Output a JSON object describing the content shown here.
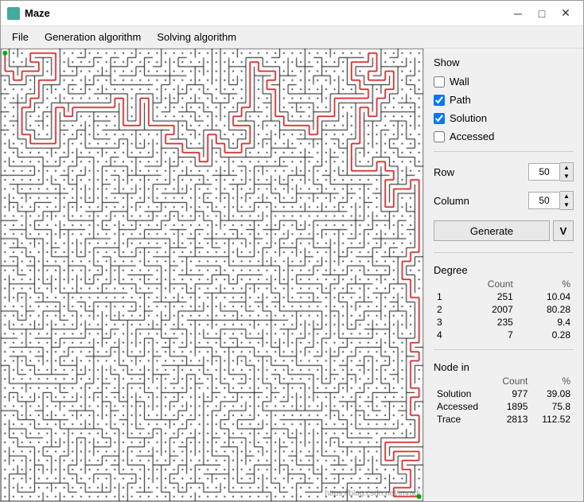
{
  "window": {
    "title": "Maze",
    "icon_color": "#4a9",
    "min_label": "─",
    "max_label": "□",
    "close_label": "✕"
  },
  "menu": {
    "items": [
      {
        "id": "file",
        "label": "File"
      },
      {
        "id": "generation",
        "label": "Generation algorithm"
      },
      {
        "id": "solving",
        "label": "Solving algorithm"
      }
    ]
  },
  "sidebar": {
    "show_label": "Show",
    "checkboxes": [
      {
        "id": "wall",
        "label": "Wall",
        "checked": false
      },
      {
        "id": "path",
        "label": "Path",
        "checked": true
      },
      {
        "id": "solution",
        "label": "Solution",
        "checked": true
      },
      {
        "id": "accessed",
        "label": "Accessed",
        "checked": false
      }
    ],
    "row_label": "Row",
    "column_label": "Column",
    "row_value": "50",
    "column_value": "50",
    "generate_label": "Generate",
    "v_label": "V",
    "degree_label": "Degree",
    "degree_headers": [
      "",
      "Count",
      "%"
    ],
    "degree_rows": [
      {
        "degree": "1",
        "count": "251",
        "pct": "10.04"
      },
      {
        "degree": "2",
        "count": "2007",
        "pct": "80.28"
      },
      {
        "degree": "3",
        "count": "235",
        "pct": "9.4"
      },
      {
        "degree": "4",
        "count": "7",
        "pct": "0.28"
      }
    ],
    "node_in_label": "Node in",
    "node_headers": [
      "",
      "Count",
      "%"
    ],
    "node_rows": [
      {
        "name": "Solution",
        "count": "977",
        "pct": "39.08"
      },
      {
        "name": "Accessed",
        "count": "1895",
        "pct": "75.8"
      },
      {
        "name": "Trace",
        "count": "2813",
        "pct": "112.52"
      }
    ]
  },
  "watermark": "https://blog.csdn.net/imradj"
}
